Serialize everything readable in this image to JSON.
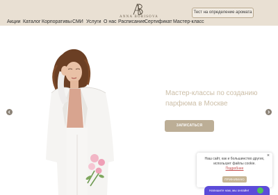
{
  "header": {
    "brand_letters": "AB",
    "brand_name": "ANNA BORISOVA",
    "test_button_label": "Тест на определение аромата"
  },
  "nav": {
    "items": [
      "Акции",
      "Каталог",
      "Корпоративы",
      "СМИ",
      "Услуги",
      "О нас",
      "Расписание",
      "Сертификат",
      "Мастер-класс"
    ]
  },
  "hero": {
    "title": "Мастер-классы по созданию парфюма в Москве",
    "cta_label": "ЗАПИСАТЬСЯ"
  },
  "cookie": {
    "text": "Наш сайт, как и большинство других, использует файлы cookie.",
    "link_label": "Подробнее",
    "accept_label": "ПРИНИМАЮ",
    "close_symbol": "×"
  },
  "chat": {
    "label": "Напишите нам, мы онлайн!"
  },
  "colors": {
    "header_bg": "#e9e0d3",
    "accent": "#bcae96",
    "hero_title": "#cbbda6",
    "chat": "#5c4bd9"
  }
}
